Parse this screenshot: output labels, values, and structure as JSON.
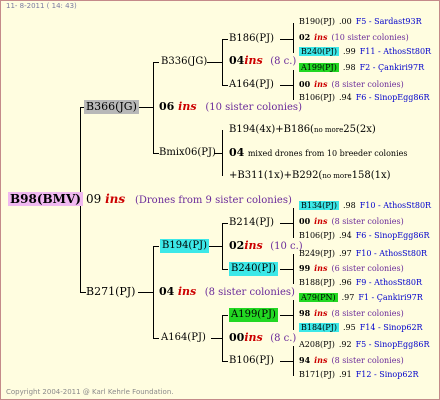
{
  "header": {
    "date": "11- 8-2011 ( 14: 43)"
  },
  "footer": {
    "copyright": "Copyright 2004-2011 @ Karl Kehrle Foundation."
  },
  "colors": {
    "pink": "#f0b8f0",
    "gray": "#b8b8b8",
    "cyan": "#3ce8e8",
    "green": "#22d822",
    "bg": "#fffde0"
  },
  "root": {
    "label": "B98(BMV)",
    "gen": "09",
    "ins": "ins",
    "note": "(Drones from 9 sister colonies)"
  },
  "n_b366": {
    "label": "B366(JG)",
    "gen": "06",
    "ins": "ins",
    "note": "(10 sister colonies)"
  },
  "n_b336": {
    "label": "B336(JG)",
    "gen": "04",
    "ins": "ins",
    "note": "(8 c.)"
  },
  "n_b186": {
    "label": "B186(PJ)"
  },
  "n_a164a": {
    "label": "A164(PJ)"
  },
  "n_bmix": {
    "label": "Bmix06(PJ)",
    "gen": "04",
    "note": "mixed drones from 10 breeder colonies"
  },
  "n_b194x": {
    "label": "B194(4x)+B186(",
    "small": "no more",
    "tail": "25(2x)"
  },
  "n_b311": {
    "label": "+B311(1x)+B292(",
    "small": "no more",
    "tail": "158(1x)"
  },
  "n_b271": {
    "label": "B271(PJ)",
    "gen": "04",
    "ins": "ins",
    "note": "(8 sister colonies)"
  },
  "n_b194": {
    "label": "B194(PJ)",
    "gen": "02",
    "ins": "ins",
    "note": "(10 c.)"
  },
  "n_b214": {
    "label": "B214(PJ)"
  },
  "n_b240b": {
    "label": "B240(PJ)"
  },
  "n_a164b": {
    "label": "A164(PJ)",
    "gen": "00",
    "ins": "ins",
    "note": "(8 c.)"
  },
  "n_a199b": {
    "label": "A199(PJ)"
  },
  "n_b106b": {
    "label": "B106(PJ)"
  },
  "leaves": [
    {
      "label": "B190(PJ)",
      "val": ".00",
      "info": "F5 - Sardast93R"
    },
    {
      "label": "02",
      "ins": "ins",
      "note": "(10 sister colonies)"
    },
    {
      "label": "B240(PJ)",
      "val": ".99",
      "info": "F11 - AthosSt80R"
    },
    {
      "label": "A199(PJ)",
      "val": ".98",
      "info": "F2 - Çankiri97R"
    },
    {
      "label": "00",
      "ins": "ins",
      "note": "(8 sister colonies)"
    },
    {
      "label": "B106(PJ)",
      "val": ".94",
      "info": "F6 - SinopEgg86R"
    },
    {
      "label": "B134(PJ)",
      "val": ".98",
      "info": "F10 - AthosSt80R"
    },
    {
      "label": "00",
      "ins": "ins",
      "note": "(8 sister colonies)"
    },
    {
      "label": "B106(PJ)",
      "val": ".94",
      "info": "F6 - SinopEgg86R"
    },
    {
      "label": "B249(PJ)",
      "val": ".97",
      "info": "F10 - AthosSt80R"
    },
    {
      "label": "99",
      "ins": "ins",
      "note": "(6 sister colonies)"
    },
    {
      "label": "B188(PJ)",
      "val": ".96",
      "info": "F9 - AthosSt80R"
    },
    {
      "label": "A79(PN)",
      "val": ".97",
      "info": "F1 - Çankiri97R"
    },
    {
      "label": "98",
      "ins": "ins",
      "note": "(8 sister colonies)"
    },
    {
      "label": "B184(PJ)",
      "val": ".95",
      "info": "F14 - Sinop62R"
    },
    {
      "label": "A208(PJ)",
      "val": ".92",
      "info": "F5 - SinopEgg86R"
    },
    {
      "label": "94",
      "ins": "ins",
      "note": "(8 sister colonies)"
    },
    {
      "label": "B171(PJ)",
      "val": ".91",
      "info": "F12 - Sinop62R"
    }
  ]
}
